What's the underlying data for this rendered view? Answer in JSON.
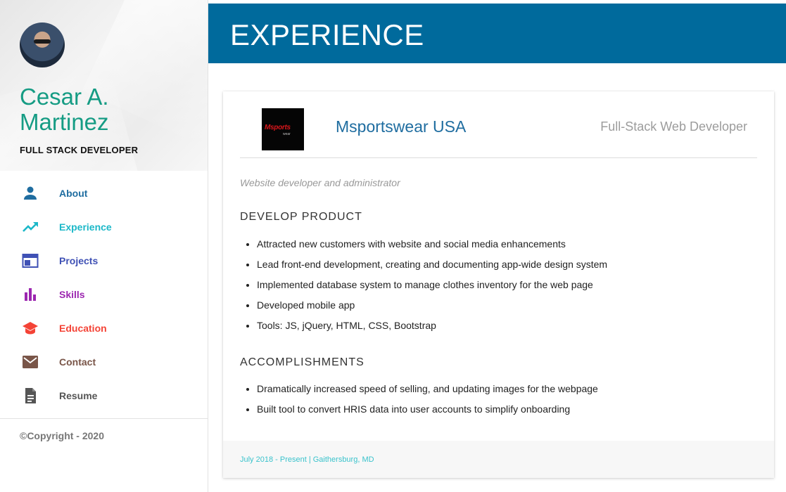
{
  "profile": {
    "name": "Cesar A. Martinez",
    "title": "FULL STACK DEVELOPER"
  },
  "nav": {
    "items": [
      {
        "label": "About",
        "icon": "person-icon",
        "color": "#1f6da0"
      },
      {
        "label": "Experience",
        "icon": "trending-up-icon",
        "color": "#1cb8c8"
      },
      {
        "label": "Projects",
        "icon": "web-window-icon",
        "color": "#3f51b5"
      },
      {
        "label": "Skills",
        "icon": "bar-chart-icon",
        "color": "#9c27b0"
      },
      {
        "label": "Education",
        "icon": "graduation-cap-icon",
        "color": "#f44336"
      },
      {
        "label": "Contact",
        "icon": "mail-icon",
        "color": "#795548"
      },
      {
        "label": "Resume",
        "icon": "document-icon",
        "color": "#555555"
      }
    ]
  },
  "footer": {
    "copyright": "©Copyright - 2020"
  },
  "header": {
    "title": "EXPERIENCE",
    "color": "#006a9c"
  },
  "job": {
    "logo_text": "Msports",
    "logo_sub": "wear",
    "company": "Msportswear USA",
    "role": "Full-Stack Web Developer",
    "subtitle": "Website developer and administrator",
    "sections": [
      {
        "heading": "DEVELOP PRODUCT",
        "bullets": [
          "Attracted new customers with website and social media enhancements",
          "Lead front-end development, creating and documenting app-wide design system",
          "Implemented database system to manage clothes inventory for the web page",
          "Developed mobile app",
          "Tools: JS, jQuery, HTML, CSS, Bootstrap"
        ]
      },
      {
        "heading": "ACCOMPLISHMENTS",
        "bullets": [
          "Dramatically increased speed of selling, and updating images for the webpage",
          "Built tool to convert HRIS data into user accounts to simplify onboarding"
        ]
      }
    ],
    "footer": "July 2018 - Present | Gaithersburg, MD"
  }
}
